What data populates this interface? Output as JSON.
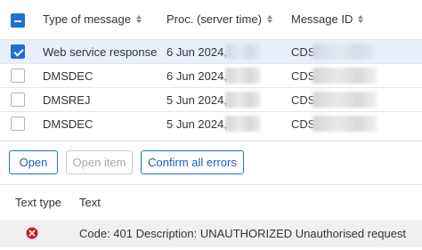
{
  "table": {
    "columns": {
      "type": "Type of message",
      "proc_time": "Proc. (server time)",
      "message_id": "Message ID"
    },
    "rows": [
      {
        "type": "Web service response",
        "date": "6 Jun 2024,",
        "id_prefix": "CDS.",
        "selected": true
      },
      {
        "type": "DMSDEC",
        "date": "6 Jun 2024,",
        "id_prefix": "CDS.",
        "selected": false
      },
      {
        "type": "DMSREJ",
        "date": "5 Jun 2024,",
        "id_prefix": "CDS.",
        "selected": false
      },
      {
        "type": "DMSDEC",
        "date": "5 Jun 2024,",
        "id_prefix": "CDS.",
        "selected": false
      }
    ]
  },
  "actions": {
    "open": "Open",
    "open_item": "Open item",
    "confirm_all": "Confirm all errors"
  },
  "errors": {
    "columns": {
      "text_type": "Text type",
      "text": "Text"
    },
    "rows": [
      {
        "icon": "error-circle-icon",
        "text": "Code: 401  Description: UNAUTHORIZED Unauthorised request"
      }
    ]
  },
  "colors": {
    "accent": "#1f6fd6",
    "selected_row": "#e8f0fc",
    "error_red": "#d6182b"
  }
}
